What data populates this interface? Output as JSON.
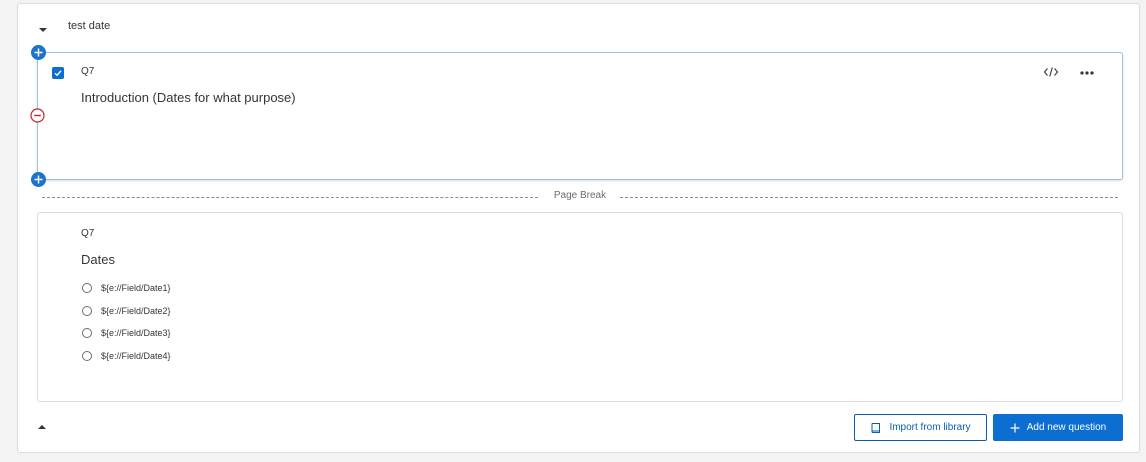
{
  "block": {
    "title": "test date"
  },
  "selected_question": {
    "number": "Q7",
    "text": "Introduction (Dates for what purpose)",
    "checked": true
  },
  "page_break": {
    "label": "Page Break"
  },
  "question": {
    "number": "Q7",
    "text": "Dates",
    "choices": [
      {
        "label": "${e://Field/Date1}"
      },
      {
        "label": "${e://Field/Date2}"
      },
      {
        "label": "${e://Field/Date3}"
      },
      {
        "label": "${e://Field/Date4}"
      }
    ]
  },
  "footer": {
    "import_label": "Import from library",
    "add_label": "Add new question"
  },
  "colors": {
    "accent": "#0b6ed0",
    "selected_border": "#9cc0de",
    "remove_red": "#c0262d"
  },
  "icons": [
    "collapse-caret-down-icon",
    "checkbox-checked-icon",
    "code-icon",
    "more-options-icon",
    "add-above-icon",
    "remove-question-icon",
    "add-below-icon",
    "collapse-caret-up-icon",
    "library-book-icon",
    "plus-icon"
  ]
}
